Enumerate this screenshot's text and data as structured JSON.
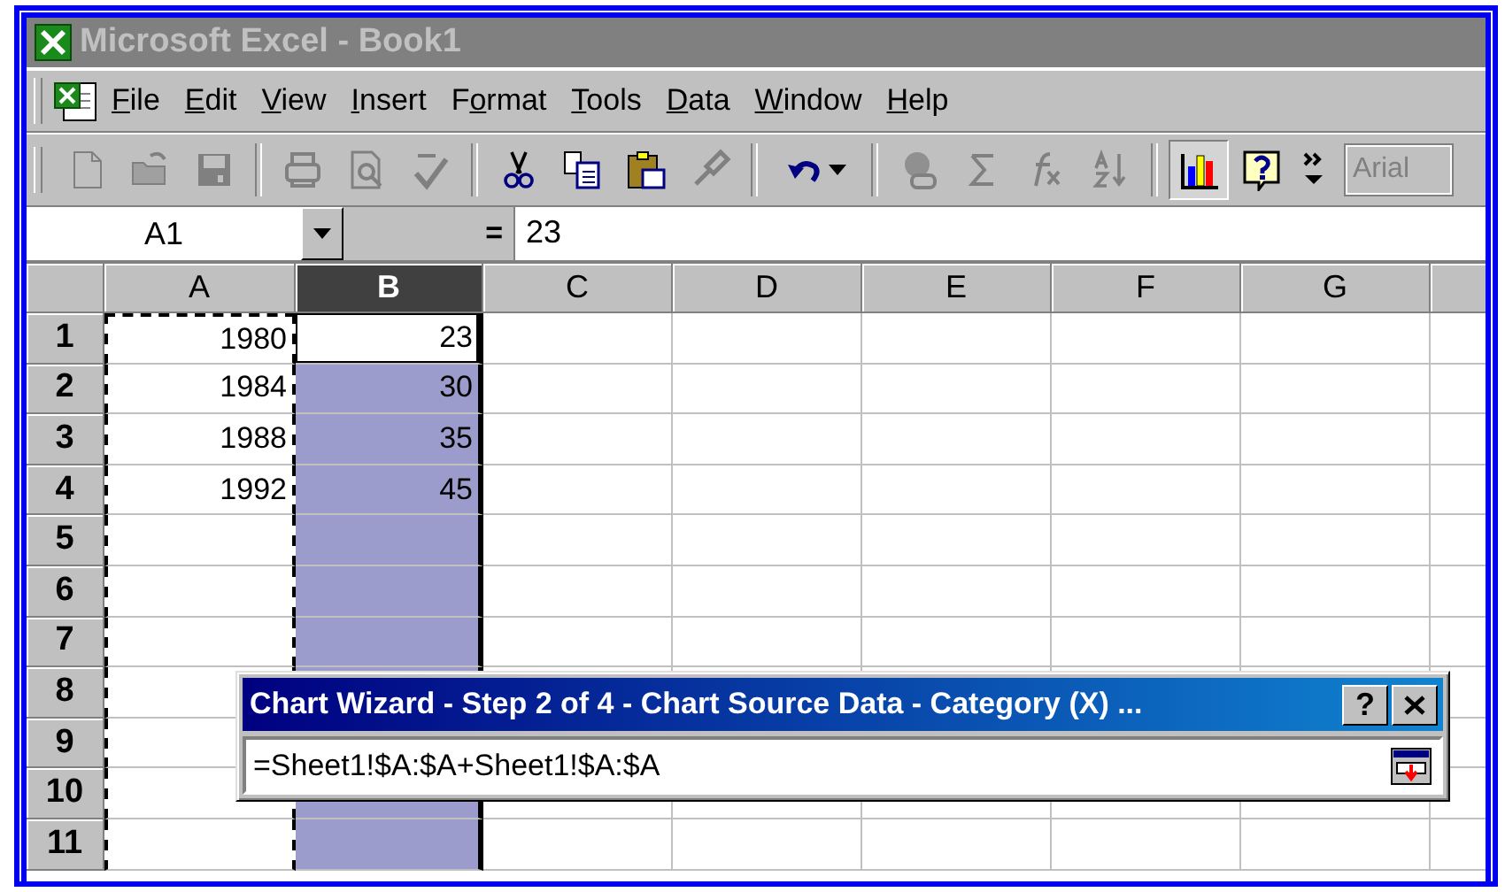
{
  "window": {
    "title": "Microsoft Excel - Book1",
    "active": false
  },
  "menu": [
    {
      "key": "F",
      "after": "ile"
    },
    {
      "key": "E",
      "after": "dit"
    },
    {
      "key": "V",
      "after": "iew"
    },
    {
      "key": "I",
      "after": "nsert"
    },
    {
      "before": "F",
      "key": "o",
      "after": "rmat"
    },
    {
      "key": "T",
      "after": "ools"
    },
    {
      "key": "D",
      "after": "ata"
    },
    {
      "key": "W",
      "after": "indow"
    },
    {
      "key": "H",
      "after": "elp"
    }
  ],
  "toolbar": [
    {
      "kind": "new",
      "disabled": true
    },
    {
      "kind": "open",
      "disabled": true
    },
    {
      "kind": "save",
      "disabled": true
    },
    {
      "kind": "separator"
    },
    {
      "kind": "print",
      "disabled": true
    },
    {
      "kind": "preview",
      "disabled": true
    },
    {
      "kind": "spelling",
      "disabled": true
    },
    {
      "kind": "separator"
    },
    {
      "kind": "cut",
      "disabled": false
    },
    {
      "kind": "copy",
      "disabled": false
    },
    {
      "kind": "paste",
      "disabled": false
    },
    {
      "kind": "painter",
      "disabled": true
    },
    {
      "kind": "separator"
    },
    {
      "kind": "undo",
      "disabled": false
    },
    {
      "kind": "separator"
    },
    {
      "kind": "hyperlink",
      "disabled": true
    },
    {
      "kind": "sum",
      "disabled": true
    },
    {
      "kind": "function",
      "disabled": true
    },
    {
      "kind": "sort",
      "disabled": true
    },
    {
      "kind": "separator"
    },
    {
      "kind": "chart",
      "disabled": false,
      "pressed": true
    },
    {
      "kind": "help",
      "disabled": false
    },
    {
      "kind": "more",
      "disabled": false
    },
    {
      "kind": "font",
      "value": "Arial",
      "disabled": true
    }
  ],
  "formula_bar": {
    "name_box": "A1",
    "equals": "=",
    "value": "23"
  },
  "sheet": {
    "columns": [
      {
        "label": "A",
        "selected": false,
        "marquee": true
      },
      {
        "label": "B",
        "selected": true,
        "marquee": false
      },
      {
        "label": "C",
        "selected": false,
        "marquee": false
      },
      {
        "label": "D",
        "selected": false,
        "marquee": false
      },
      {
        "label": "E",
        "selected": false,
        "marquee": false
      },
      {
        "label": "F",
        "selected": false,
        "marquee": false
      },
      {
        "label": "G",
        "selected": false,
        "marquee": false
      }
    ],
    "rows": [
      {
        "header": "1",
        "active": true,
        "cells": [
          "1980",
          "23"
        ]
      },
      {
        "header": "2",
        "active": false,
        "cells": [
          "1984",
          "30"
        ]
      },
      {
        "header": "3",
        "active": false,
        "cells": [
          "1988",
          "35"
        ]
      },
      {
        "header": "4",
        "active": false,
        "cells": [
          "1992",
          "45"
        ]
      },
      {
        "header": "5",
        "active": false,
        "cells": []
      },
      {
        "header": "6",
        "active": false,
        "cells": []
      },
      {
        "header": "7",
        "active": false,
        "cells": []
      },
      {
        "header": "8",
        "active": false,
        "cells": []
      },
      {
        "header": "9",
        "cells": []
      },
      {
        "header": "10",
        "active": false,
        "cells": []
      },
      {
        "header": "11",
        "active": false,
        "cells": []
      }
    ]
  },
  "dialog": {
    "title": "Chart Wizard - Step 2 of 4 - Chart Source Data - Category (X) ...",
    "help_button": "?",
    "field_value": "=Sheet1!$A:$A+Sheet1!$A:$A"
  }
}
